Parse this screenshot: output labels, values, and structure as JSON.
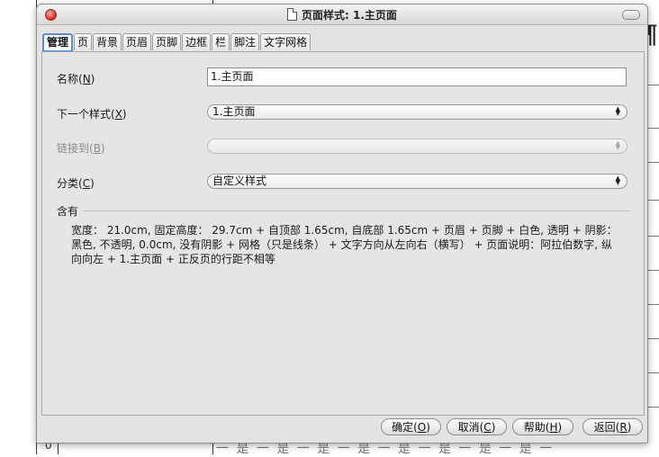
{
  "window": {
    "title": "页面样式: 1.主页面"
  },
  "tabs": [
    {
      "label": "管理",
      "active": true
    },
    {
      "label": "页"
    },
    {
      "label": "背景"
    },
    {
      "label": "页眉"
    },
    {
      "label": "页脚"
    },
    {
      "label": "边框"
    },
    {
      "label": "栏"
    },
    {
      "label": "脚注"
    },
    {
      "label": "文字网格"
    }
  ],
  "form": {
    "name_label": "名称(",
    "name_key": "N",
    "name_value": "1.主页面",
    "next_label": "下一个样式(",
    "next_key": "X",
    "next_value": "1.主页面",
    "link_label": "链接到(",
    "link_key": "B",
    "link_value": "",
    "category_label": "分类(",
    "category_key": "C",
    "category_value": "自定义样式",
    "close_paren": ")"
  },
  "contains": {
    "label": "含有",
    "description": "宽度： 21.0cm, 固定高度： 29.7cm + 自顶部 1.65cm, 自底部 1.65cm + 页眉 + 页脚 + 白色, 透明 + 阴影：黑色, 不透明, 0.0cm, 没有阴影 + 网格（只是线条） + 文字方向从左向右（横写） + 页面说明：阿拉伯数字, 纵向向左 + 1.主页面 + 正反页的行距不相等"
  },
  "buttons": {
    "ok": {
      "label": "确定(",
      "key": "O"
    },
    "cancel": {
      "label": "取消(",
      "key": "C"
    },
    "help": {
      "label": "帮助(",
      "key": "H"
    },
    "reset": {
      "label": "返回(",
      "key": "R"
    }
  },
  "background": {
    "pilcrow": "¶",
    "zero": "0",
    "bottom_text": "一 是 一 是 一 是 一 是 一 是 一 是 一 是 一 是 一"
  },
  "icons": {
    "close": "close-icon",
    "document": "document-icon",
    "zoom": "zoom-icon",
    "dropdown": "updown-arrows-icon"
  },
  "colors": {
    "accent": "#5a8cd6",
    "close_button": "#e2362a"
  }
}
